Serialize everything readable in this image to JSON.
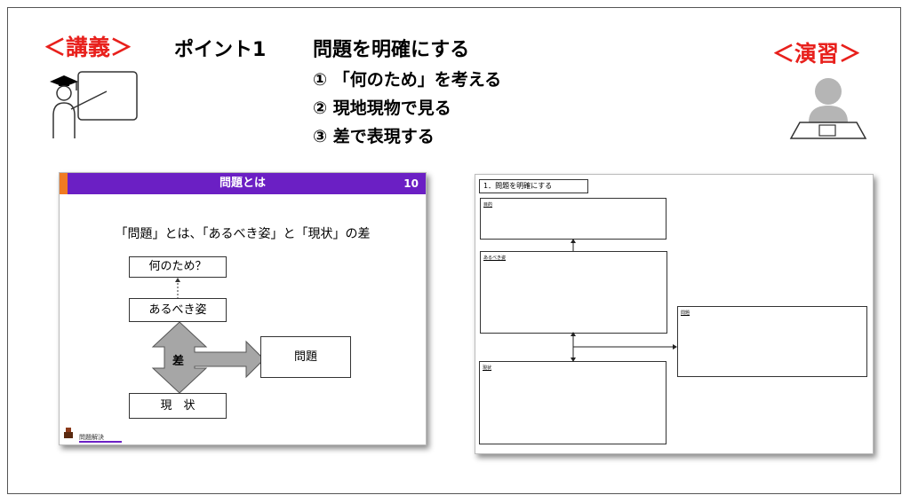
{
  "header": {
    "lecture_label": "＜講義＞",
    "point_label": "ポイント1",
    "title": "問題を明確にする",
    "items": [
      "① 「何のため」を考える",
      "② 現地現物で見る",
      "③ 差で表現する"
    ],
    "exercise_label": "＜演習＞"
  },
  "lecture_slide": {
    "title": "問題とは",
    "page_number": "10",
    "caption": "「問題」とは、「あるべき姿」と「現状」の差",
    "box_purpose": "何のため？",
    "box_ideal": "あるべき姿",
    "box_current": "現　状",
    "arrow_label": "差",
    "box_problem": "問題",
    "footer": "問題解決"
  },
  "worksheet": {
    "title": "1．問題を明確にする",
    "label_purpose": "目的",
    "label_ideal": "あるべき姿",
    "label_problem": "問題",
    "label_current": "現状"
  },
  "colors": {
    "accent_red": "#e8201c",
    "slide_bar": "#6b1fc4",
    "slide_orange": "#f07a22",
    "arrow_gray": "#a6a6a6"
  }
}
